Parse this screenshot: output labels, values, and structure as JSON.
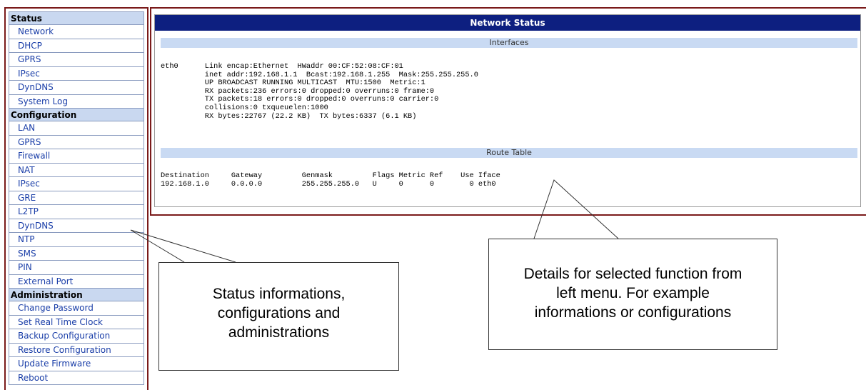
{
  "sidebar": {
    "sections": [
      {
        "title": "Status",
        "items": [
          "Network",
          "DHCP",
          "GPRS",
          "IPsec",
          "DynDNS",
          "System Log"
        ]
      },
      {
        "title": "Configuration",
        "items": [
          "LAN",
          "GPRS",
          "Firewall",
          "NAT",
          "IPsec",
          "GRE",
          "L2TP",
          "DynDNS",
          "NTP",
          "SMS",
          "PIN",
          "External Port"
        ]
      },
      {
        "title": "Administration",
        "items": [
          "Change Password",
          "Set Real Time Clock",
          "Backup Configuration",
          "Restore Configuration",
          "Update Firmware",
          "Reboot"
        ]
      }
    ]
  },
  "main": {
    "title": "Network Status",
    "interfaces": {
      "heading": "Interfaces",
      "lines": [
        "eth0      Link encap:Ethernet  HWaddr 00:CF:52:08:CF:01",
        "          inet addr:192.168.1.1  Bcast:192.168.1.255  Mask:255.255.255.0",
        "          UP BROADCAST RUNNING MULTICAST  MTU:1500  Metric:1",
        "          RX packets:236 errors:0 dropped:0 overruns:0 frame:0",
        "          TX packets:18 errors:0 dropped:0 overruns:0 carrier:0",
        "          collisions:0 txqueuelen:1000",
        "          RX bytes:22767 (22.2 KB)  TX bytes:6337 (6.1 KB)"
      ]
    },
    "route_table": {
      "heading": "Route Table",
      "lines": [
        "Destination     Gateway         Genmask         Flags Metric Ref    Use Iface",
        "192.168.1.0     0.0.0.0         255.255.255.0   U     0      0        0 eth0"
      ]
    }
  },
  "callouts": {
    "left": [
      "Status informations,",
      "configurations and",
      "administrations"
    ],
    "right": [
      "Details for selected function from",
      "left menu. For example",
      "informations or configurations"
    ]
  },
  "colors": {
    "frame_border": "#7a1a1a",
    "title_bar": "#0d1f80",
    "section_bar": "#c9daf3",
    "menu_section_bg": "#c9d8f0",
    "menu_link": "#1a3ea8"
  }
}
